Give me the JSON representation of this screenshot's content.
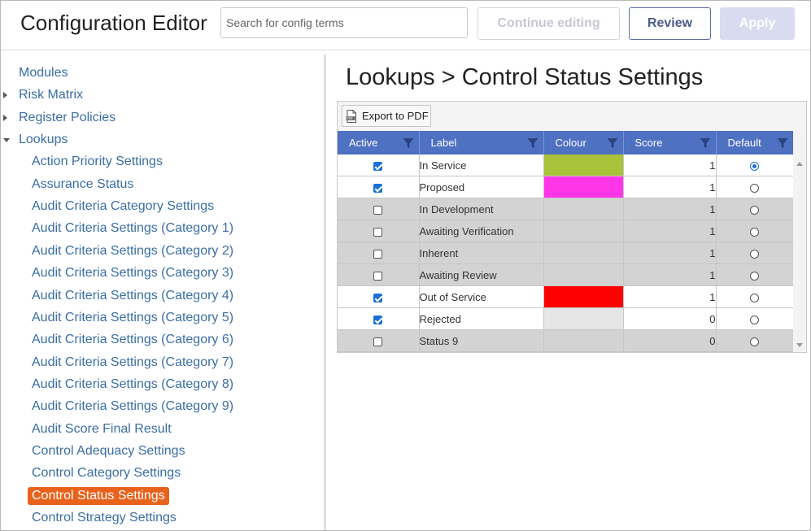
{
  "header": {
    "title": "Configuration Editor",
    "search_placeholder": "Search for config terms",
    "continue_label": "Continue editing",
    "review_label": "Review",
    "apply_label": "Apply"
  },
  "sidebar": {
    "items": [
      {
        "label": "Modules",
        "level": 0,
        "arrow": "none"
      },
      {
        "label": "Risk Matrix",
        "level": 0,
        "arrow": "right"
      },
      {
        "label": "Register Policies",
        "level": 0,
        "arrow": "right"
      },
      {
        "label": "Lookups",
        "level": 0,
        "arrow": "down"
      },
      {
        "label": "Action Priority Settings",
        "level": 1
      },
      {
        "label": "Assurance Status",
        "level": 1
      },
      {
        "label": "Audit Criteria Category Settings",
        "level": 1
      },
      {
        "label": "Audit Criteria Settings (Category 1)",
        "level": 1
      },
      {
        "label": "Audit Criteria Settings (Category 2)",
        "level": 1
      },
      {
        "label": "Audit Criteria Settings (Category 3)",
        "level": 1
      },
      {
        "label": "Audit Criteria Settings (Category 4)",
        "level": 1
      },
      {
        "label": "Audit Criteria Settings (Category 5)",
        "level": 1
      },
      {
        "label": "Audit Criteria Settings (Category 6)",
        "level": 1
      },
      {
        "label": "Audit Criteria Settings (Category 7)",
        "level": 1
      },
      {
        "label": "Audit Criteria Settings (Category 8)",
        "level": 1
      },
      {
        "label": "Audit Criteria Settings (Category 9)",
        "level": 1
      },
      {
        "label": "Audit Score Final Result",
        "level": 1
      },
      {
        "label": "Control Adequacy Settings",
        "level": 1
      },
      {
        "label": "Control Category Settings",
        "level": 1
      },
      {
        "label": "Control Status Settings",
        "level": 1,
        "selected": true
      },
      {
        "label": "Control Strategy Settings",
        "level": 1
      }
    ]
  },
  "main": {
    "breadcrumb": "Lookups > Control Status Settings",
    "export_label": "Export to PDF",
    "columns": [
      {
        "key": "active",
        "label": "Active"
      },
      {
        "key": "label",
        "label": "Label"
      },
      {
        "key": "colour",
        "label": "Colour"
      },
      {
        "key": "score",
        "label": "Score"
      },
      {
        "key": "default",
        "label": "Default"
      }
    ],
    "rows": [
      {
        "active": true,
        "label": "In Service",
        "colour": "#a8c23a",
        "score": "1",
        "default": true
      },
      {
        "active": true,
        "label": "Proposed",
        "colour": "#ff36e8",
        "score": "1",
        "default": false
      },
      {
        "active": false,
        "label": "In Development",
        "colour": "",
        "score": "1",
        "default": false
      },
      {
        "active": false,
        "label": "Awaiting Verification",
        "colour": "",
        "score": "1",
        "default": false
      },
      {
        "active": false,
        "label": "Inherent",
        "colour": "",
        "score": "1",
        "default": false
      },
      {
        "active": false,
        "label": "Awaiting Review",
        "colour": "",
        "score": "1",
        "default": false
      },
      {
        "active": true,
        "label": "Out of Service",
        "colour": "#ff0000",
        "score": "1",
        "default": false
      },
      {
        "active": true,
        "label": "Rejected",
        "colour": "#e6e6e6",
        "score": "0",
        "default": false
      },
      {
        "active": false,
        "label": "Status 9",
        "colour": "",
        "score": "0",
        "default": false
      }
    ]
  },
  "colors": {
    "link": "#3a6ea5",
    "selected": "#e8621b",
    "grid_header": "#4e71c2",
    "check_blue": "#1a6fd8"
  }
}
